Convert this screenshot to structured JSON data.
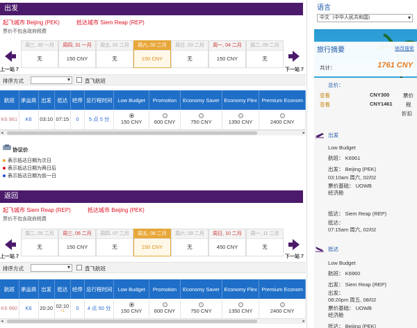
{
  "outbound": {
    "header": "出发",
    "from": "起飞城市 Beijing (PEK)",
    "to": "抵达城市 Siem Reap (REP)",
    "tax_note": "票价不包含政府税费",
    "prev_label": "上一站 7",
    "next_label": "下一站 7",
    "dates": [
      {
        "label": "周三, 30 一月",
        "price": "无",
        "style": "grey"
      },
      {
        "label": "周四, 31 一月",
        "price": "150 CNY",
        "style": "red"
      },
      {
        "label": "周五, 01 二月",
        "price": "无",
        "style": "grey"
      },
      {
        "label": "周六, 02 二月",
        "price": "150 CNY",
        "style": "selected"
      },
      {
        "label": "周日, 03 二月",
        "price": "无",
        "style": "grey"
      },
      {
        "label": "周一, 04 二月",
        "price": "150 CNY",
        "style": "red"
      },
      {
        "label": "周二, 05 二月",
        "price": "无",
        "style": "grey"
      }
    ],
    "sort_label": "排序方式",
    "direct_label": "直飞航班",
    "flight": {
      "flight_no": "K6 961",
      "carrier": "K6",
      "dep": "03:10",
      "arr": "07:15",
      "stops": "0",
      "duration": "5 点 5 分",
      "prices": [
        "150 CNY",
        "600 CNY",
        "750 CNY",
        "1350 CNY",
        "2400 CNY"
      ]
    }
  },
  "inbound": {
    "header": "返回",
    "from": "起飞城市 Siem Reap (REP)",
    "to": "抵达城市 Beijing (PEK)",
    "tax_note": "票价不包含政府税费",
    "prev_label": "上一站 7",
    "next_label": "下一站 7",
    "dates": [
      {
        "label": "周二, 05 二月",
        "price": "无",
        "style": "grey"
      },
      {
        "label": "周三, 06 二月",
        "price": "150 CNY",
        "style": "red"
      },
      {
        "label": "周四, 07 二月",
        "price": "无",
        "style": "grey"
      },
      {
        "label": "周五, 08 二月",
        "price": "150 CNY",
        "style": "selected"
      },
      {
        "label": "周六, 09 二月",
        "price": "无",
        "style": "grey"
      },
      {
        "label": "周日, 10 二月",
        "price": "450 CNY",
        "style": "red"
      },
      {
        "label": "周一, 11 二月",
        "price": "无",
        "style": "grey"
      }
    ],
    "sort_label": "排序方式",
    "direct_label": "直飞航班",
    "flight": {
      "flight_no": "K6 960",
      "carrier": "K6",
      "dep": "20:20",
      "arr": "02:10",
      "arr_note": "+1",
      "stops": "0",
      "duration": "4 点 50 分",
      "prices": [
        "150 CNY",
        "600 CNY",
        "750 CNY",
        "1350 CNY",
        "2400 CNY"
      ]
    }
  },
  "table_headers": [
    "航班",
    "承运商",
    "出发",
    "抵达",
    "经停",
    "总行程时间",
    "Low Budget",
    "Promotion",
    "Economy Saver",
    "Economy Flex",
    "Premium Econom"
  ],
  "legend": {
    "title": "协议价",
    "rows": [
      {
        "text": "表示抵达日期为次日",
        "color": "#e8a73a"
      },
      {
        "text": "表示抵达日期为两日后",
        "color": "#d12"
      },
      {
        "text": "表示抵达日期为前一日",
        "color": "#2a4bd1"
      }
    ]
  },
  "sidebar": {
    "lang_title": "语言",
    "lang_value": "中文（中华人民共和国）",
    "summary_title": "旅行摘要",
    "modify": "修改搜索",
    "total_label": "共计：",
    "total_value": "1761 CNY",
    "fare_label": "总价：",
    "view1": "查看",
    "amount1": "CNY300",
    "tail1": "票价",
    "view2": "查看",
    "amount2": "CNY1461",
    "tail2": "税",
    "tail3": "折扣",
    "out_section": "出发",
    "out_fare": "Low Budget",
    "out_flight": "航班： K6961",
    "out_dep_label": "出发： Beijing (PEK)",
    "out_dep_time": "03:10am 周六, 02/02",
    "out_basis": "票价基础： UOWB",
    "out_class": "经济舱",
    "out_arr_label": "抵达： Siem Reap (REP)",
    "out_arr_sub": "抵达：",
    "out_arr_time": "07:15am 周六, 02/02",
    "in_section": "抵达",
    "in_fare": "Low Budget",
    "in_flight": "航班： K6960",
    "in_dep_label": "出发： Siem Reap (REP)",
    "in_dep_sub": "出发：",
    "in_dep_time": "08:20pm 周五, 08/02",
    "in_basis": "票价基础： UOWB",
    "in_class": "经济舱",
    "in_arr_label": "抵达： Beijing (PEK)"
  }
}
